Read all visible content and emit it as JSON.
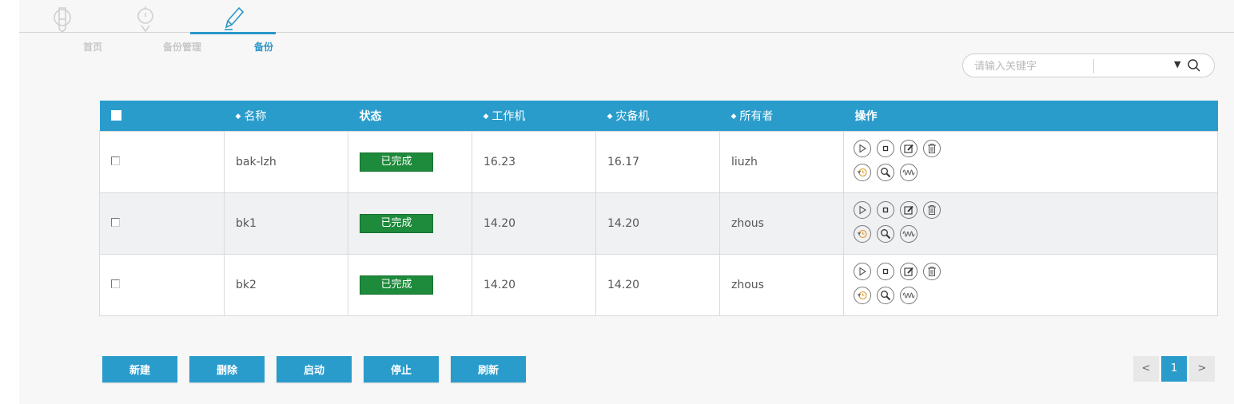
{
  "nav": {
    "items": [
      {
        "label": "首页",
        "icon": "home-icon",
        "active": false
      },
      {
        "label": "备份管理",
        "icon": "backup-manage-icon",
        "active": false
      },
      {
        "label": "备份",
        "icon": "pencil-icon",
        "active": true
      }
    ]
  },
  "search": {
    "placeholder": "请输入关键字",
    "selected": "",
    "dropdown_icon": "caret-down-icon",
    "icon": "search-icon"
  },
  "table": {
    "headers": {
      "name": "名称",
      "status": "状态",
      "worker": "工作机",
      "standby": "灾备机",
      "owner": "所有者",
      "actions": "操作"
    },
    "rows": [
      {
        "name": "bak-lzh",
        "status": "已完成",
        "worker": "16.23",
        "standby": "16.17",
        "owner": "liuzh"
      },
      {
        "name": "bk1",
        "status": "已完成",
        "worker": "14.20",
        "standby": "14.20",
        "owner": "zhous"
      },
      {
        "name": "bk2",
        "status": "已完成",
        "worker": "14.20",
        "standby": "14.20",
        "owner": "zhous"
      }
    ],
    "row_action_icons": [
      "play-icon",
      "stop-icon",
      "edit-icon",
      "trash-icon",
      "restore-history-icon",
      "search-icon",
      "waveform-icon"
    ]
  },
  "buttons": {
    "new": "新建",
    "delete": "删除",
    "start": "启动",
    "stop": "停止",
    "refresh": "刷新"
  },
  "pagination": {
    "prev": "<",
    "current": "1",
    "next": ">"
  },
  "colors": {
    "accent": "#2a9ccc",
    "status_done": "#1e8a3b",
    "restore_icon": "#e09a2a"
  }
}
